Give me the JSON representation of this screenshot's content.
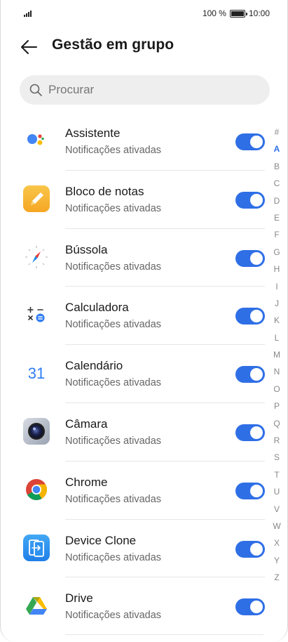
{
  "status_bar": {
    "battery_percent": "100 %",
    "time": "10:00"
  },
  "header": {
    "title": "Gestão em grupo"
  },
  "search": {
    "placeholder": "Procurar",
    "value": ""
  },
  "apps": [
    {
      "name": "Assistente",
      "status": "Notificações ativadas",
      "icon": "google-assistant-icon",
      "enabled": true
    },
    {
      "name": "Bloco de notas",
      "status": "Notificações ativadas",
      "icon": "notepad-icon",
      "enabled": true
    },
    {
      "name": "Bússola",
      "status": "Notificações ativadas",
      "icon": "compass-icon",
      "enabled": true
    },
    {
      "name": "Calculadora",
      "status": "Notificações ativadas",
      "icon": "calculator-icon",
      "enabled": true
    },
    {
      "name": "Calendário",
      "status": "Notificações ativadas",
      "icon": "calendar-icon",
      "enabled": true,
      "icon_text": "31"
    },
    {
      "name": "Câmara",
      "status": "Notificações ativadas",
      "icon": "camera-icon",
      "enabled": true
    },
    {
      "name": "Chrome",
      "status": "Notificações ativadas",
      "icon": "chrome-icon",
      "enabled": true
    },
    {
      "name": "Device Clone",
      "status": "Notificações ativadas",
      "icon": "device-clone-icon",
      "enabled": true
    },
    {
      "name": "Drive",
      "status": "Notificações ativadas",
      "icon": "google-drive-icon",
      "enabled": true
    }
  ],
  "alphabet_index": [
    "#",
    "A",
    "B",
    "C",
    "D",
    "E",
    "F",
    "G",
    "H",
    "I",
    "J",
    "K",
    "L",
    "M",
    "N",
    "O",
    "P",
    "Q",
    "R",
    "S",
    "T",
    "U",
    "V",
    "W",
    "X",
    "Y",
    "Z"
  ],
  "alphabet_active": "A",
  "colors": {
    "accent": "#2f6fe6",
    "secondary_text": "#666666",
    "search_bg": "#eeeeee"
  }
}
